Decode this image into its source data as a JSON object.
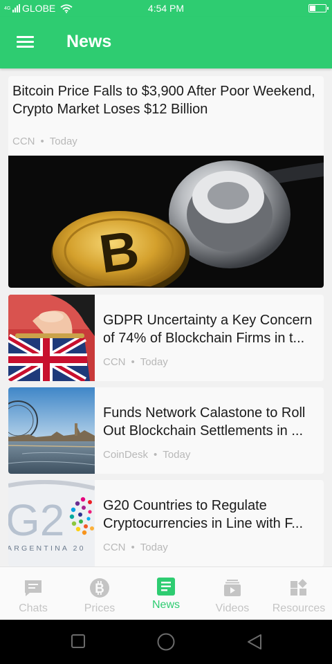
{
  "status_bar": {
    "carrier": "GLOBE",
    "network_badge": "4G",
    "time": "4:54 PM",
    "battery_percent": 30
  },
  "app_bar": {
    "title": "News",
    "menu_icon": "hamburger-menu-icon"
  },
  "articles": [
    {
      "title": "Bitcoin Price Falls to $3,900 After Poor Weekend, Crypto Market Loses $12 Billion",
      "source": "CCN",
      "time": "Today",
      "image": "bitcoin-coin-and-stethoscope"
    },
    {
      "title_line1": "GDPR Uncertainty a Key Concern",
      "title_line2": "of 74% of Blockchain Firms in t...",
      "source": "CCN",
      "time": "Today",
      "image": "union-jack-purse"
    },
    {
      "title_line1": "Funds Network Calastone to Roll",
      "title_line2": "Out Blockchain Settlements in ...",
      "source": "CoinDesk",
      "time": "Today",
      "image": "london-eye-thames"
    },
    {
      "title_line1": "G20 Countries to Regulate",
      "title_line2": "Cryptocurrencies in Line with F...",
      "source": "CCN",
      "time": "Today",
      "image": "g20-argentina-logo",
      "image_text": "ARGENTINA 20"
    }
  ],
  "bottom_nav": [
    {
      "label": "Chats",
      "icon": "chat-icon",
      "active": false
    },
    {
      "label": "Prices",
      "icon": "bitcoin-icon",
      "active": false
    },
    {
      "label": "News",
      "icon": "news-icon",
      "active": true
    },
    {
      "label": "Videos",
      "icon": "video-icon",
      "active": false
    },
    {
      "label": "Resources",
      "icon": "resources-icon",
      "active": false
    }
  ],
  "colors": {
    "accent": "#2ecc71",
    "inactive": "#c4c4c4",
    "meta_text": "#b8b8b8"
  }
}
